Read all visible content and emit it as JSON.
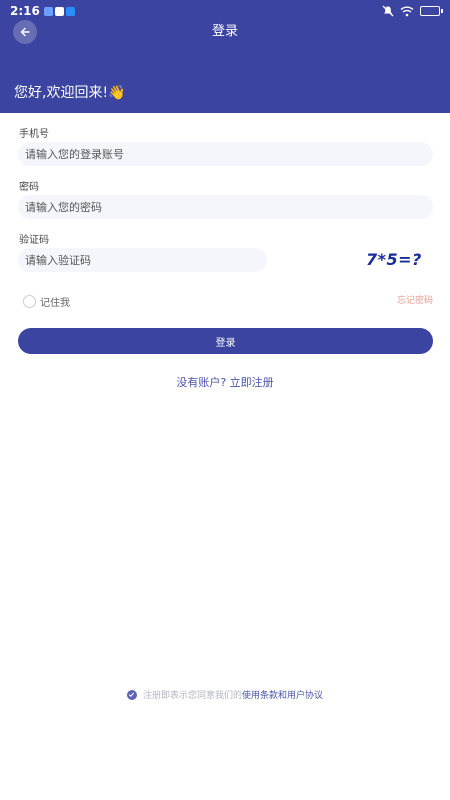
{
  "status_bar": {
    "time": "2:16"
  },
  "nav": {
    "title": "登录"
  },
  "greeting": "您好,欢迎回来!👋",
  "form": {
    "phone_label": "手机号",
    "phone_placeholder": "请输入您的登录账号",
    "password_label": "密码",
    "password_placeholder": "请输入您的密码",
    "captcha_label": "验证码",
    "captcha_placeholder": "请输入验证码",
    "captcha_text": "7*5=?",
    "remember_label": "记住我",
    "forgot_label": "忘记密码"
  },
  "login_button": "登录",
  "register": {
    "prompt": "没有账户?",
    "link": "立即注册"
  },
  "agreement": {
    "text": "注册即表示您同意我们的",
    "link": "使用条款和用户协议"
  },
  "colors": {
    "primary": "#3b44a0",
    "input_bg": "#f4f6fc",
    "forgot": "#e89b8b"
  }
}
